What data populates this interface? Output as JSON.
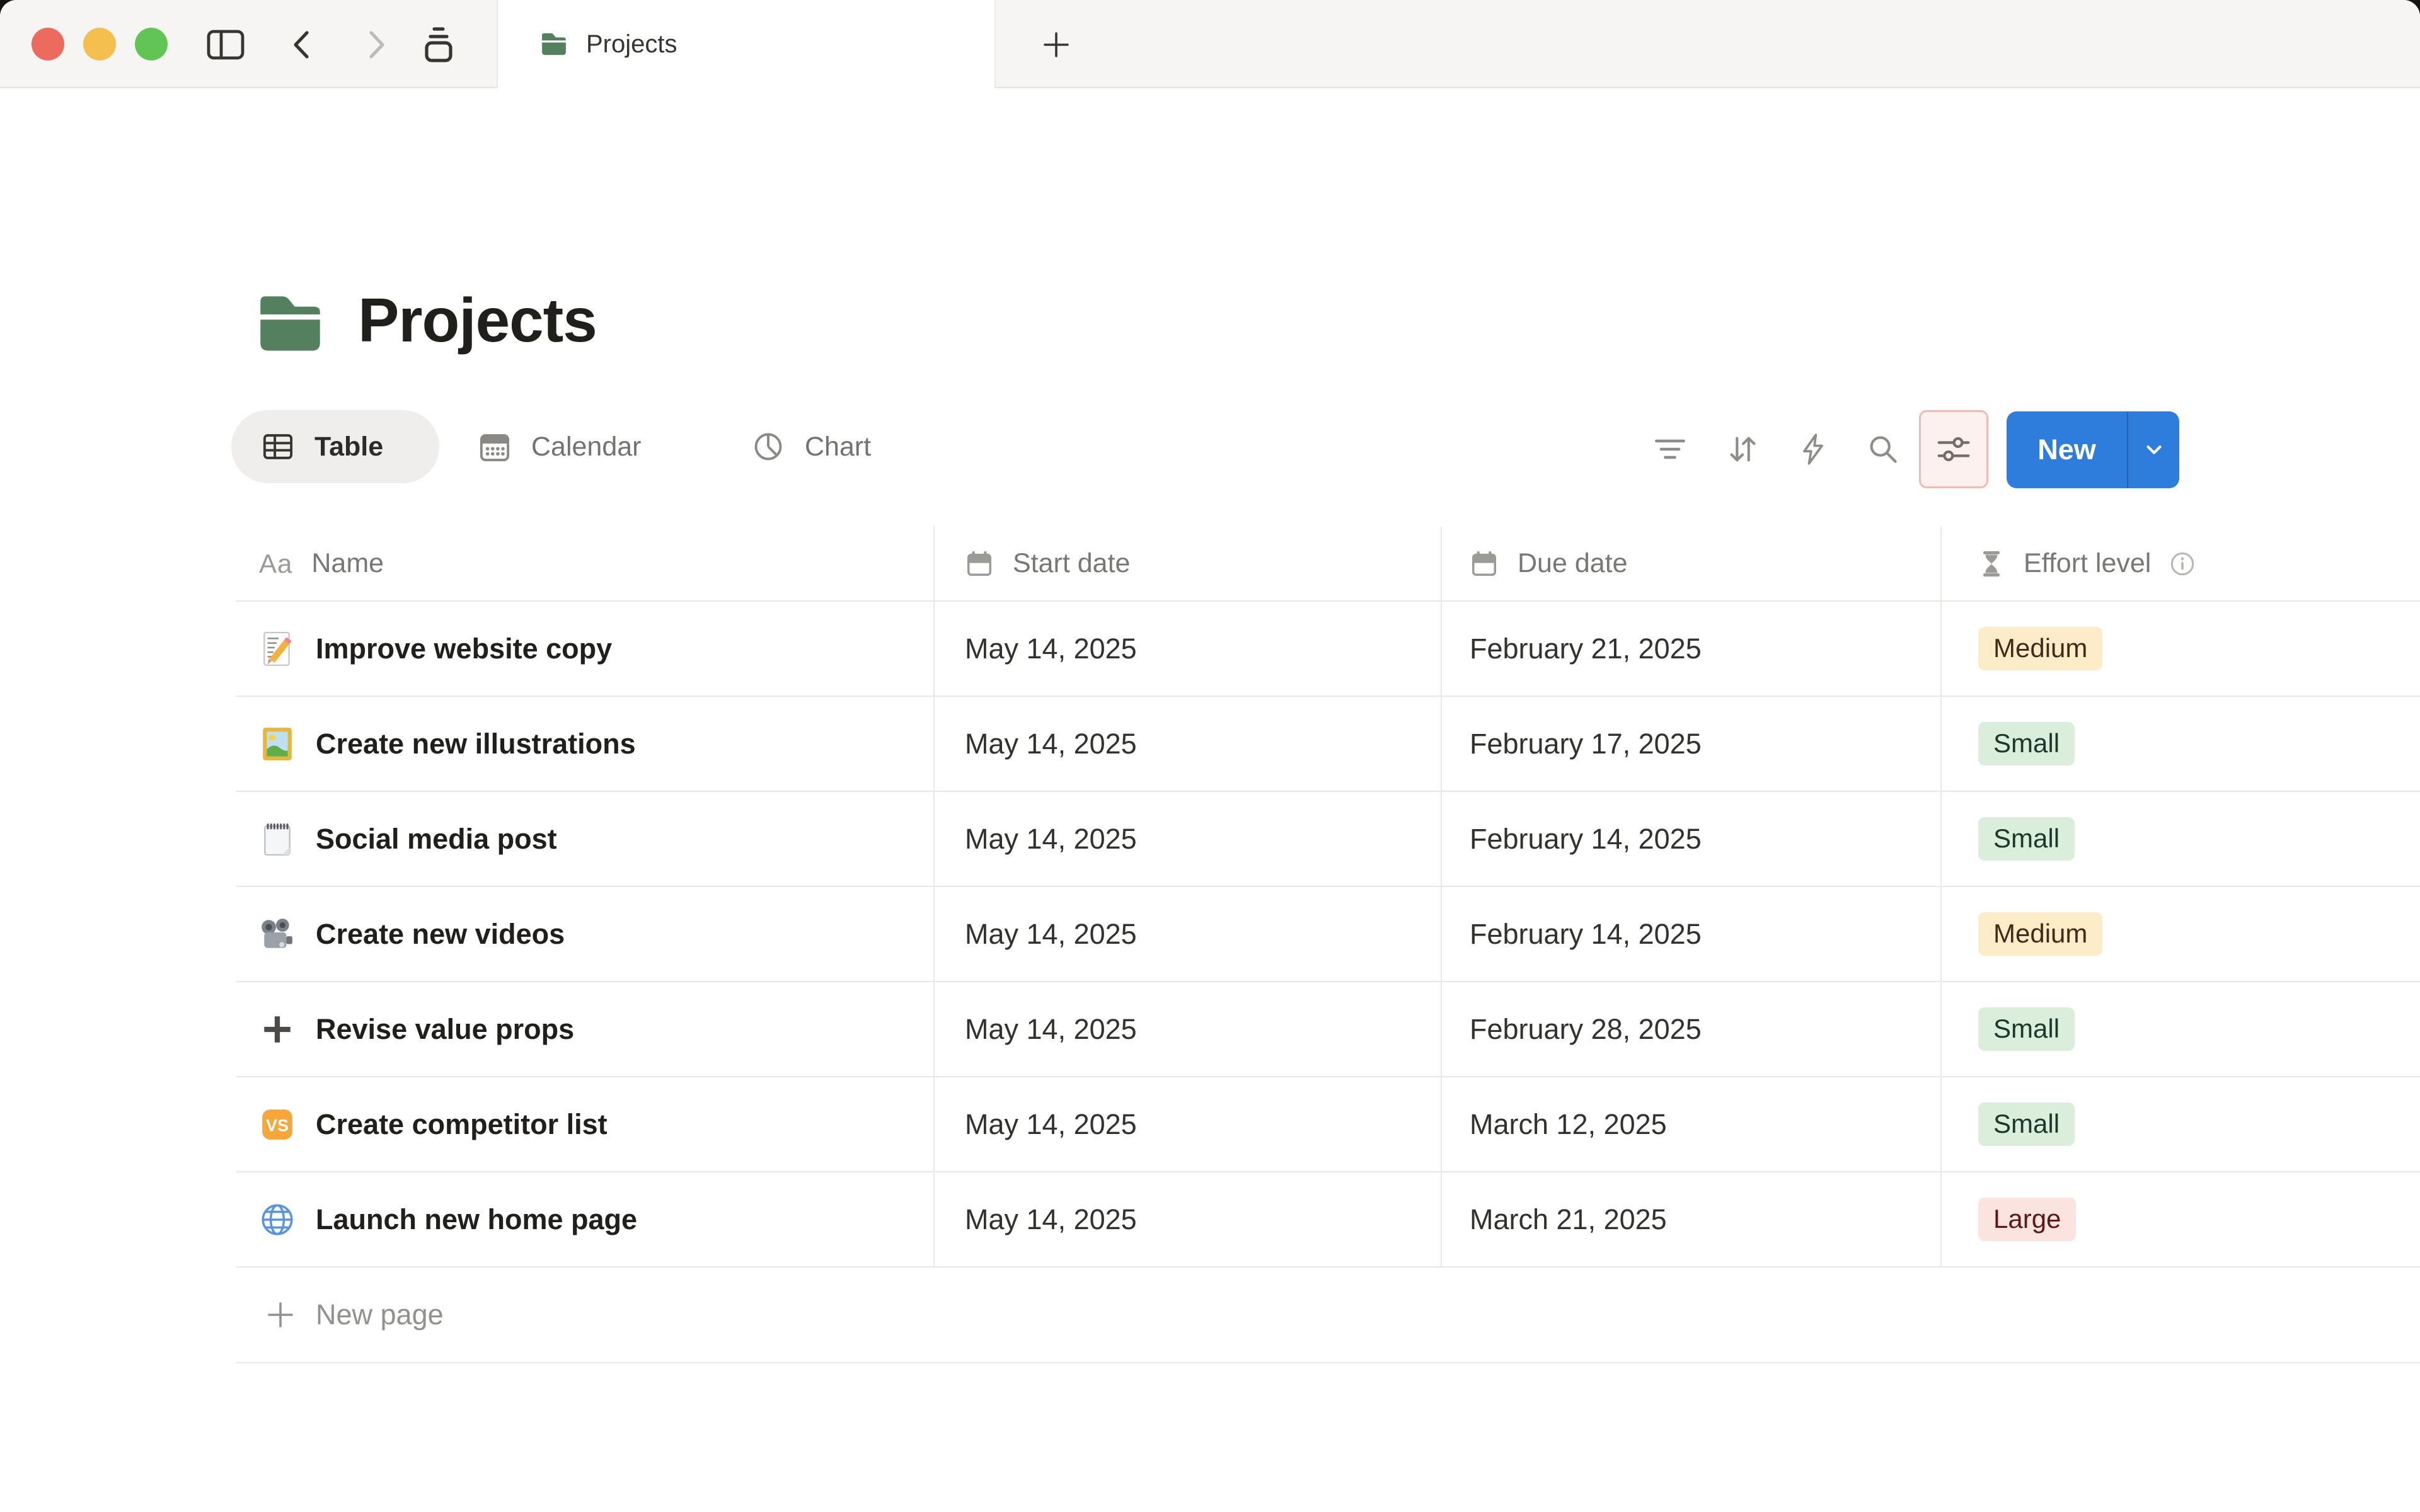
{
  "window": {
    "traffic_lights": [
      "close",
      "minimize",
      "zoom"
    ],
    "tab": {
      "title": "Projects",
      "icon": "green-folder"
    },
    "new_tab_button": "+"
  },
  "page": {
    "title": "Projects",
    "icon": "green-folder"
  },
  "views": {
    "table_label": "Table",
    "calendar_label": "Calendar",
    "chart_label": "Chart",
    "active": "Table"
  },
  "toolbar": {
    "icons": [
      "filter-icon",
      "sort-icon",
      "automation-icon",
      "search-icon",
      "view-settings-icon"
    ],
    "new_label": "New"
  },
  "table": {
    "columns": [
      {
        "label": "Name",
        "icon": "Aa"
      },
      {
        "label": "Start date",
        "icon": "calendar"
      },
      {
        "label": "Due date",
        "icon": "calendar"
      },
      {
        "label": "Effort level",
        "icon": "hourglass",
        "info": true
      }
    ],
    "rows": [
      {
        "emoji": "📝",
        "icon": "memo",
        "name": "Improve website copy",
        "start_date": "May 14, 2025",
        "due_date": "February 21, 2025",
        "effort": "Medium"
      },
      {
        "emoji": "🖼️",
        "icon": "picture",
        "name": "Create new illustrations",
        "start_date": "May 14, 2025",
        "due_date": "February 17, 2025",
        "effort": "Small"
      },
      {
        "emoji": "🗒️",
        "icon": "notepad",
        "name": "Social media post",
        "start_date": "May 14, 2025",
        "due_date": "February 14, 2025",
        "effort": "Small"
      },
      {
        "emoji": "🎥",
        "icon": "camera",
        "name": "Create new videos",
        "start_date": "May 14, 2025",
        "due_date": "February 14, 2025",
        "effort": "Medium"
      },
      {
        "emoji": "➕",
        "icon": "plus",
        "name": "Revise value props",
        "start_date": "May 14, 2025",
        "due_date": "February 28, 2025",
        "effort": "Small"
      },
      {
        "emoji": "🆚",
        "icon": "vs",
        "name": "Create competitor list",
        "start_date": "May 14, 2025",
        "due_date": "March 12, 2025",
        "effort": "Small"
      },
      {
        "emoji": "🌐",
        "icon": "globe",
        "name": "Launch new home page",
        "start_date": "May 14, 2025",
        "due_date": "March 21, 2025",
        "effort": "Large"
      }
    ],
    "new_page_label": "New page"
  },
  "emoji_art": {
    "vs_label": "VS"
  },
  "colors": {
    "accent_blue": "#2e7cdb",
    "folder_green": "#54805f",
    "tabbar_bg": "#f6f5f3",
    "settings_highlight_bg": "#fdf1ef",
    "settings_highlight_border": "#f1bab2",
    "traffic": {
      "close": "#ed6a5f",
      "minimize": "#f5bf4f",
      "zoom": "#61c554"
    },
    "effort": {
      "Medium": {
        "bg": "#fdecc8",
        "text": "#402c1b"
      },
      "Small": {
        "bg": "#dbeddb",
        "text": "#1c3829"
      },
      "Large": {
        "bg": "#fbe4e0",
        "text": "#5d1715"
      }
    }
  }
}
